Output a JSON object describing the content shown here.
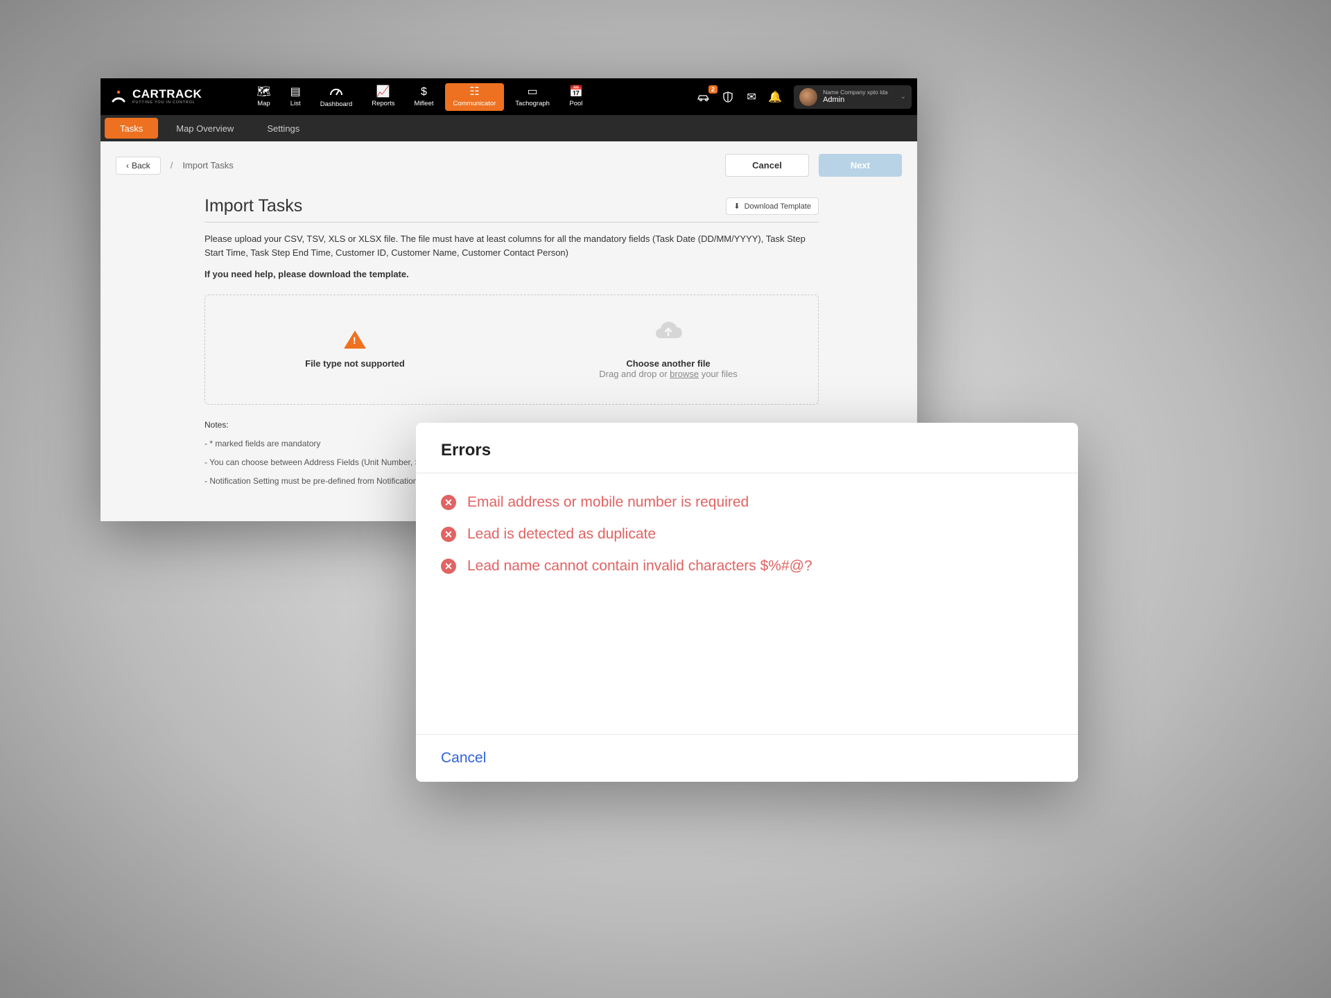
{
  "brand": {
    "name": "CARTRACK",
    "tagline": "PUTTING YOU IN CONTROL"
  },
  "nav": {
    "items": [
      {
        "label": "Map"
      },
      {
        "label": "List"
      },
      {
        "label": "Dashboard"
      },
      {
        "label": "Reports"
      },
      {
        "label": "Mifleet"
      },
      {
        "label": "Communicator"
      },
      {
        "label": "Tachograph"
      },
      {
        "label": "Pool"
      }
    ],
    "active": "Communicator",
    "badge_count": "2"
  },
  "user": {
    "company": "Name Company xpto lda",
    "role": "Admin"
  },
  "subnav": {
    "items": [
      "Tasks",
      "Map Overview",
      "Settings"
    ],
    "active": "Tasks"
  },
  "crumbs": {
    "back": "Back",
    "sep": "/",
    "current": "Import Tasks"
  },
  "actions": {
    "cancel": "Cancel",
    "next": "Next"
  },
  "page": {
    "title": "Import Tasks",
    "download": "Download Template",
    "intro": "Please upload your CSV, TSV, XLS or XLSX file. The file must have at least columns for all the mandatory fields (Task Date (DD/MM/YYYY), Task Step Start Time, Task Step End Time, Customer ID, Customer Name, Customer Contact Person)",
    "help": "If you need help, please download the template.",
    "drop": {
      "error": "File type not supported",
      "choose": "Choose another file",
      "hint_pre": "Drag and drop or ",
      "hint_link": "browse",
      "hint_post": " your files"
    },
    "notes_label": "Notes:",
    "notes": [
      "- * marked fields are mandatory",
      "- You can choose between Address Fields (Unit Number, Street Address, Postal Code...) or a Location Name pre-defined in the system. It is not required to fill up both",
      "- Notification Setting must be pre-defined from Notification Setting"
    ]
  },
  "modal": {
    "title": "Errors",
    "errors": [
      "Email address or mobile number is required",
      "Lead is detected as duplicate",
      "Lead name cannot contain invalid characters $%#@?"
    ],
    "cancel": "Cancel"
  }
}
